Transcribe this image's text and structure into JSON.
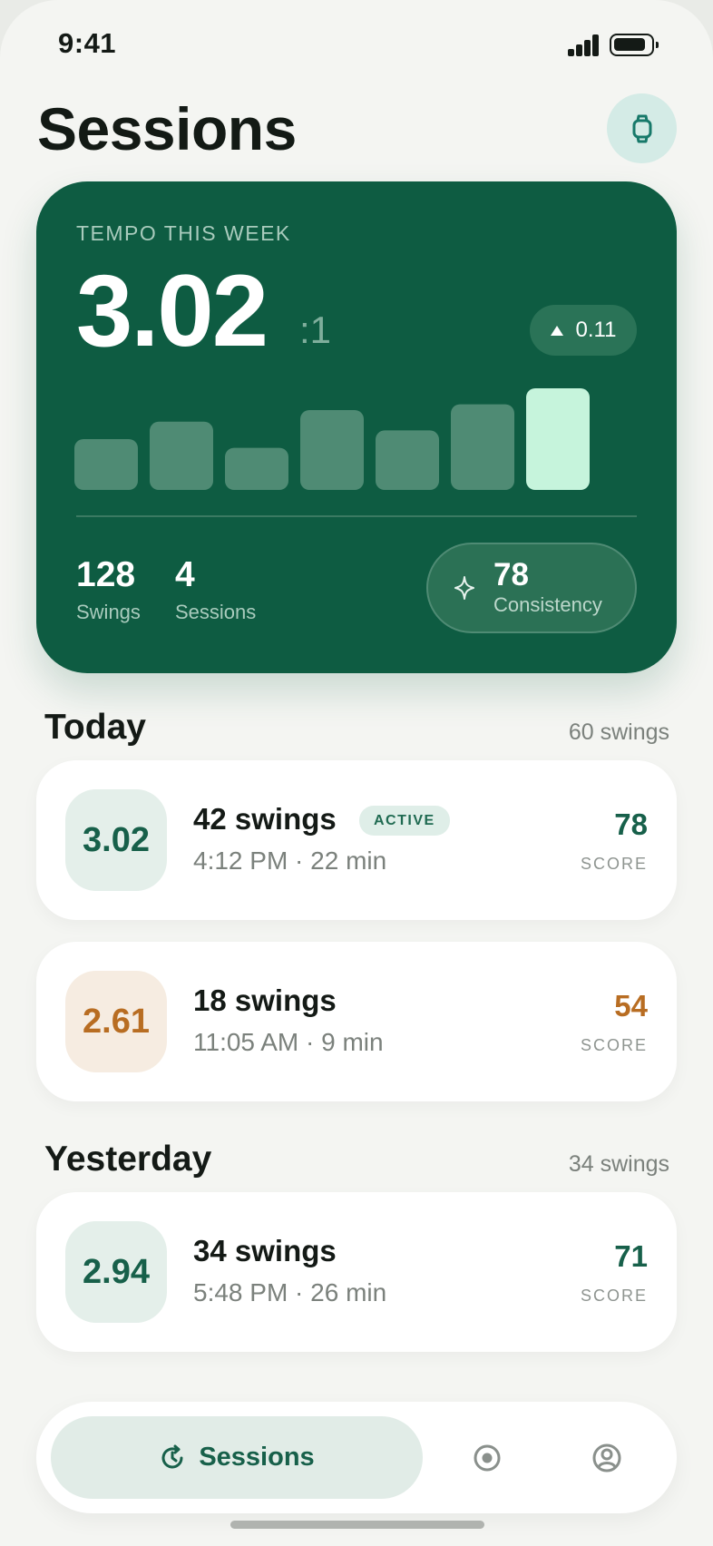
{
  "status_bar": {
    "time": "9:41"
  },
  "header": {
    "title": "Sessions",
    "watch_icon": "watch-icon"
  },
  "hero": {
    "label": "TEMPO THIS WEEK",
    "value": "3.02",
    "suffix": ":1",
    "delta": "0.11",
    "delta_direction": "up",
    "chart_data": {
      "type": "bar",
      "values": [
        0.35,
        0.47,
        0.29,
        0.55,
        0.41,
        0.59,
        0.7
      ],
      "highlight_index": 6,
      "bar_color": "#4f8b74",
      "highlight_color": "#c6f4dc"
    },
    "stats": [
      {
        "value": "128",
        "label": "Swings"
      },
      {
        "value": "4",
        "label": "Sessions"
      }
    ],
    "consistency": {
      "value": "78",
      "label": "Consistency",
      "icon": "sparkle-icon"
    }
  },
  "sections": [
    {
      "title": "Today",
      "count": "60 swings",
      "sessions": [
        {
          "tempo": "3.02",
          "title": "42 swings",
          "badge": "ACTIVE",
          "subtitle": "4:12 PM · 22 min",
          "score": "78",
          "score_label": "SCORE",
          "tone": "green"
        },
        {
          "tempo": "2.61",
          "title": "18 swings",
          "badge": "",
          "subtitle": "11:05 AM · 9 min",
          "score": "54",
          "score_label": "SCORE",
          "tone": "amber"
        }
      ]
    },
    {
      "title": "Yesterday",
      "count": "34 swings",
      "sessions": [
        {
          "tempo": "2.94",
          "title": "34 swings",
          "badge": "",
          "subtitle": "5:48 PM · 26 min",
          "score": "71",
          "score_label": "SCORE",
          "tone": "green"
        }
      ]
    }
  ],
  "tab_bar": {
    "active_label": "Sessions",
    "tabs": [
      "history-icon",
      "record-icon",
      "profile-icon"
    ]
  },
  "colors": {
    "brand": "#0e5c42",
    "accent_green": "#17604a",
    "accent_amber": "#b86d22",
    "highlight": "#c6f4dc"
  }
}
